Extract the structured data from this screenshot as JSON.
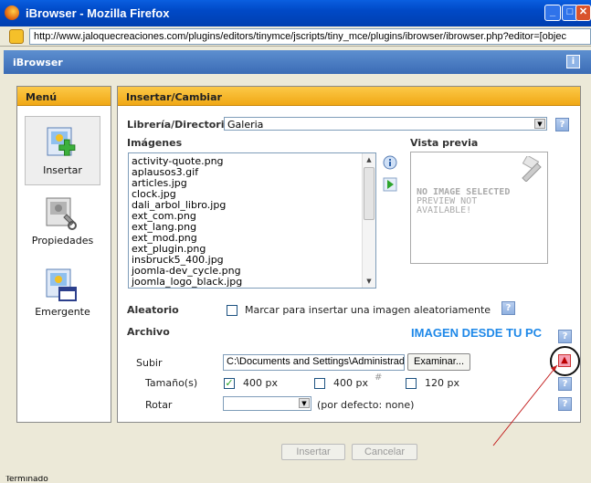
{
  "window": {
    "title": "iBrowser - Mozilla Firefox",
    "minimize": "_",
    "maximize": "□",
    "close": "✕"
  },
  "address": {
    "url": "http://www.jaloquecreaciones.com/plugins/editors/tinymce/jscripts/tiny_mce/plugins/ibrowser/ibrowser.php?editor=[objec"
  },
  "app": {
    "title": "iBrowser",
    "info_icon": "i"
  },
  "menu": {
    "title": "Menú",
    "items": [
      {
        "label": "Insertar"
      },
      {
        "label": "Propiedades"
      },
      {
        "label": "Emergente"
      }
    ]
  },
  "main": {
    "title": "Insertar/Cambiar",
    "library_label": "Librería/Directorio",
    "library_value": "Galeria",
    "images_label": "Imágenes",
    "images": [
      "activity-quote.png",
      "aplausos3.gif",
      "articles.jpg",
      "clock.jpg",
      "dali_arbol_libro.jpg",
      "ext_com.png",
      "ext_lang.png",
      "ext_mod.png",
      "ext_plugin.png",
      "insbruck5_400.jpg",
      "joomla-dev_cycle.png",
      "joomla_logo_black.jpg"
    ],
    "preview_label": "Vista previa",
    "preview_text": [
      "NO IMAGE SELECTED",
      "PREVIEW NOT",
      "AVAILABLE!"
    ],
    "random_label": "Aleatorio",
    "random_text": "Marcar para insertar una imagen aleatoriamente",
    "file_label": "Archivo",
    "annotation": "IMAGEN DESDE TU PC",
    "upload_label": "Subir",
    "upload_value": "C:\\Documents and Settings\\Administrador",
    "browse_button": "Examinar...",
    "size_label": "Tamaño(s)",
    "sizes": [
      "400 px",
      "400 px",
      "120 px"
    ],
    "rotate_label": "Rotar",
    "rotate_default": "(por defecto: none)",
    "help": "?"
  },
  "footer": {
    "insert_button": "Insertar",
    "cancel_button": "Cancelar"
  },
  "status": {
    "text": "Terminado"
  }
}
